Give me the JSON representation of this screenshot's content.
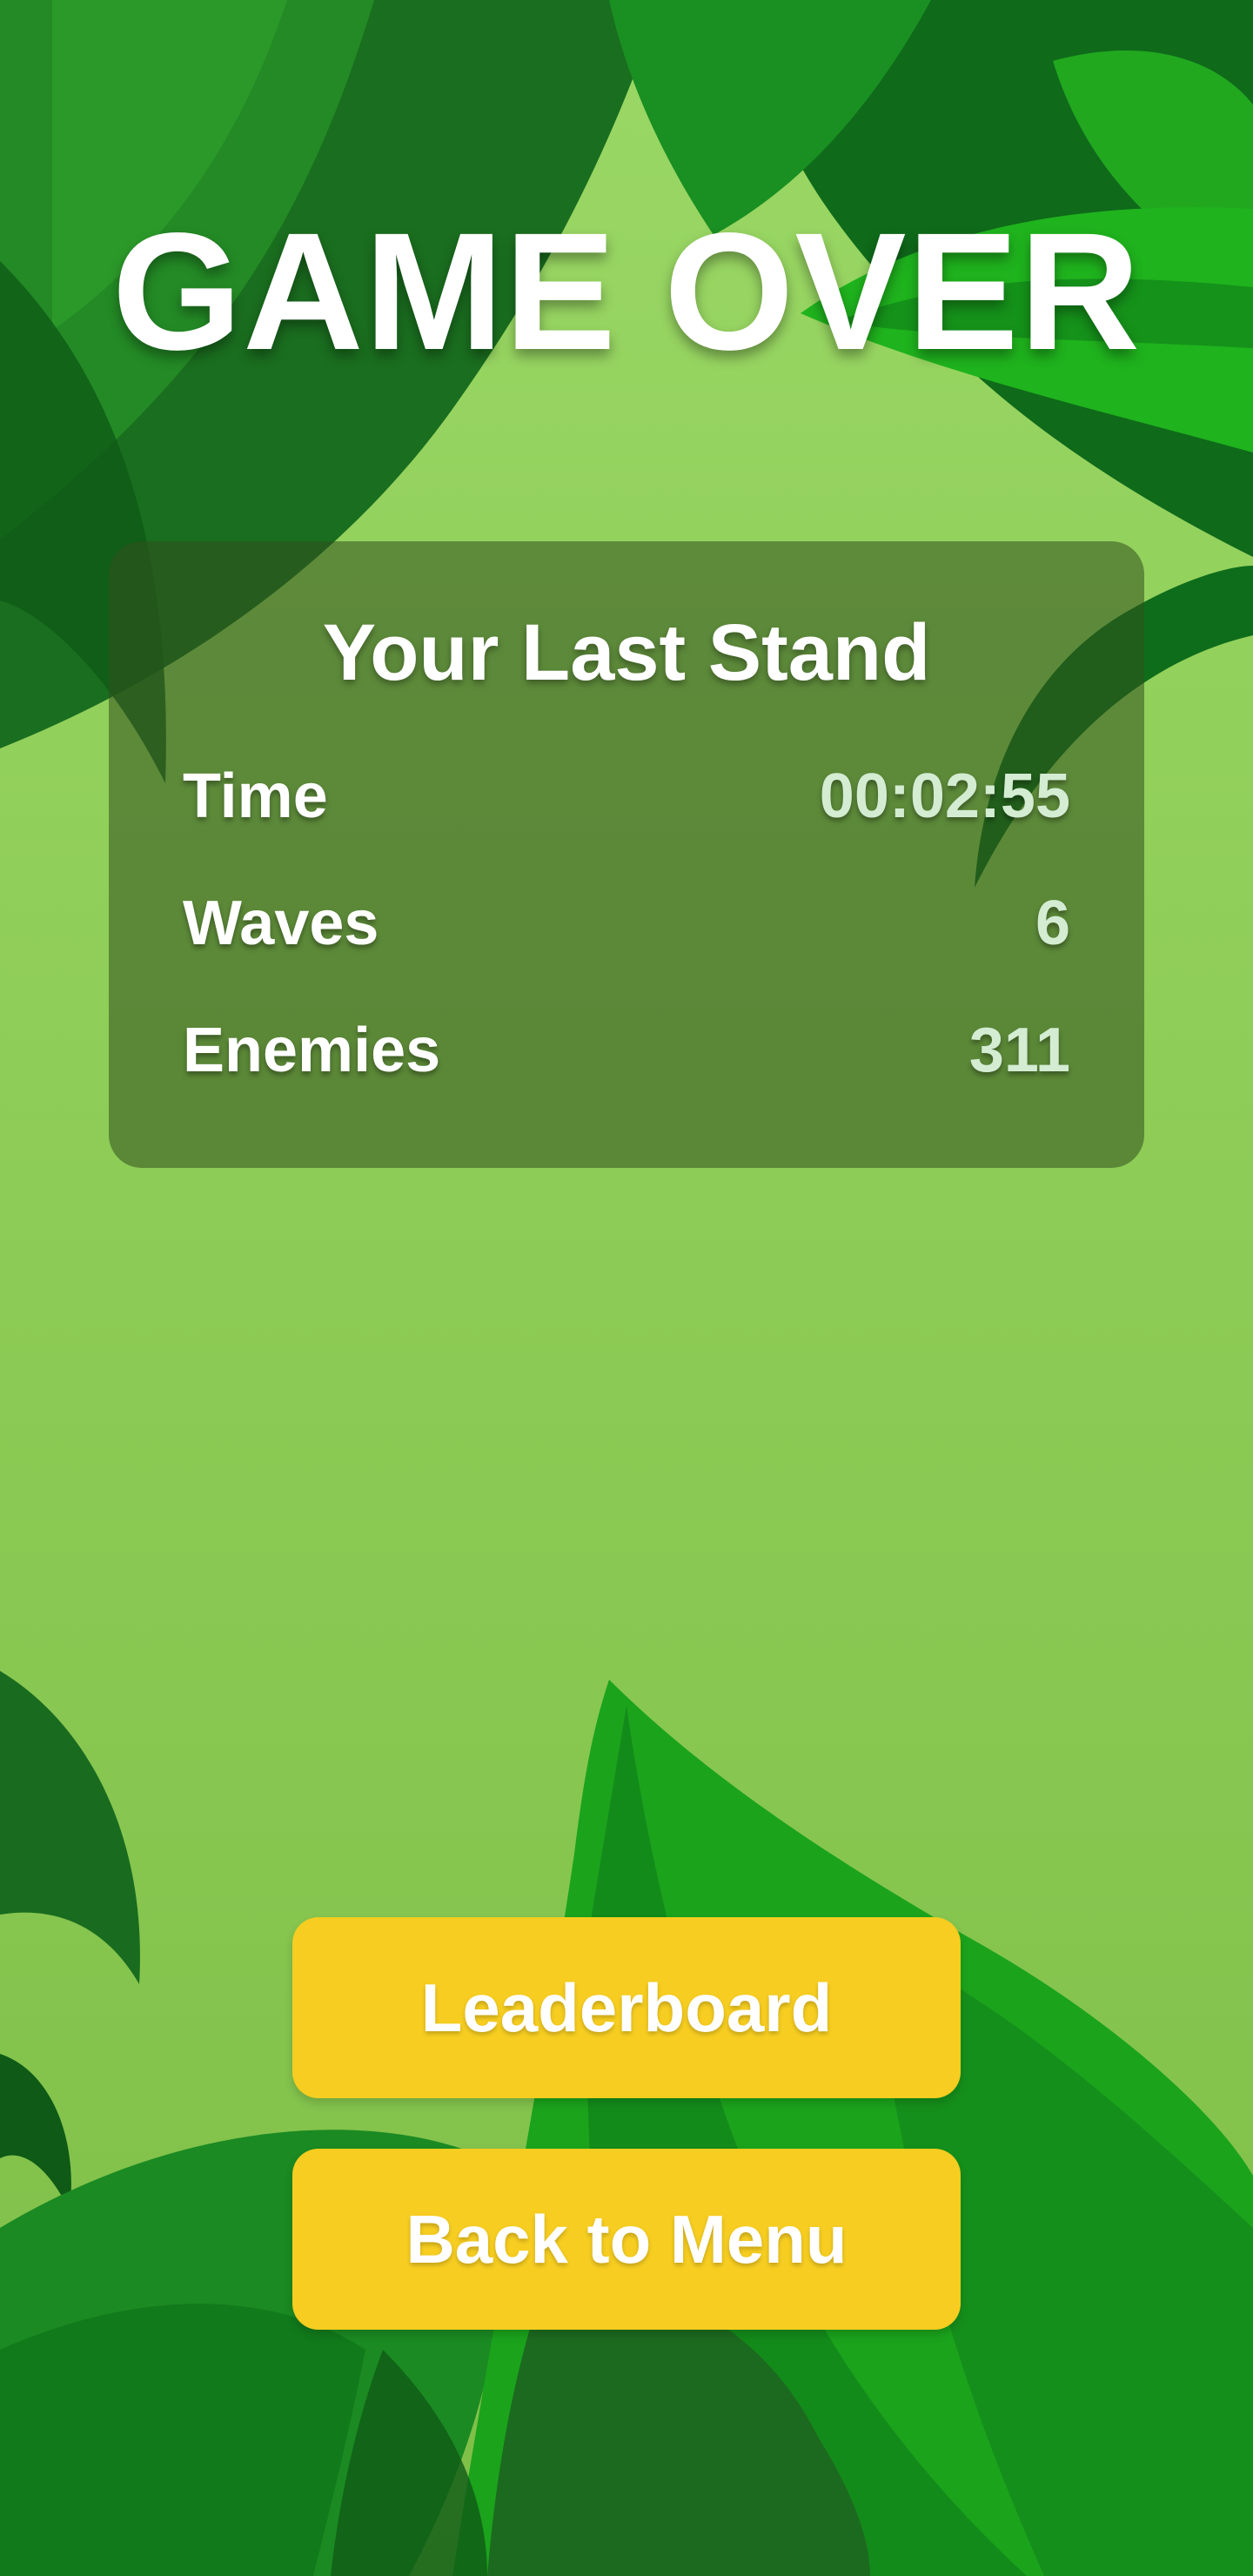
{
  "screen": {
    "title": "GAME OVER"
  },
  "stats_panel": {
    "heading": "Your Last Stand",
    "rows": [
      {
        "label": "Time",
        "value": "00:02:55"
      },
      {
        "label": "Waves",
        "value": "6"
      },
      {
        "label": "Enemies",
        "value": "311"
      }
    ]
  },
  "buttons": {
    "leaderboard": "Leaderboard",
    "back_to_menu": "Back to Menu"
  },
  "colors": {
    "grass": "#8fcf57",
    "button_yellow": "#f6cd20",
    "leaf_dark": "#1a6e1f",
    "leaf_bright": "#1fa11a",
    "panel_tint": "rgba(50,80,30,0.55)"
  }
}
